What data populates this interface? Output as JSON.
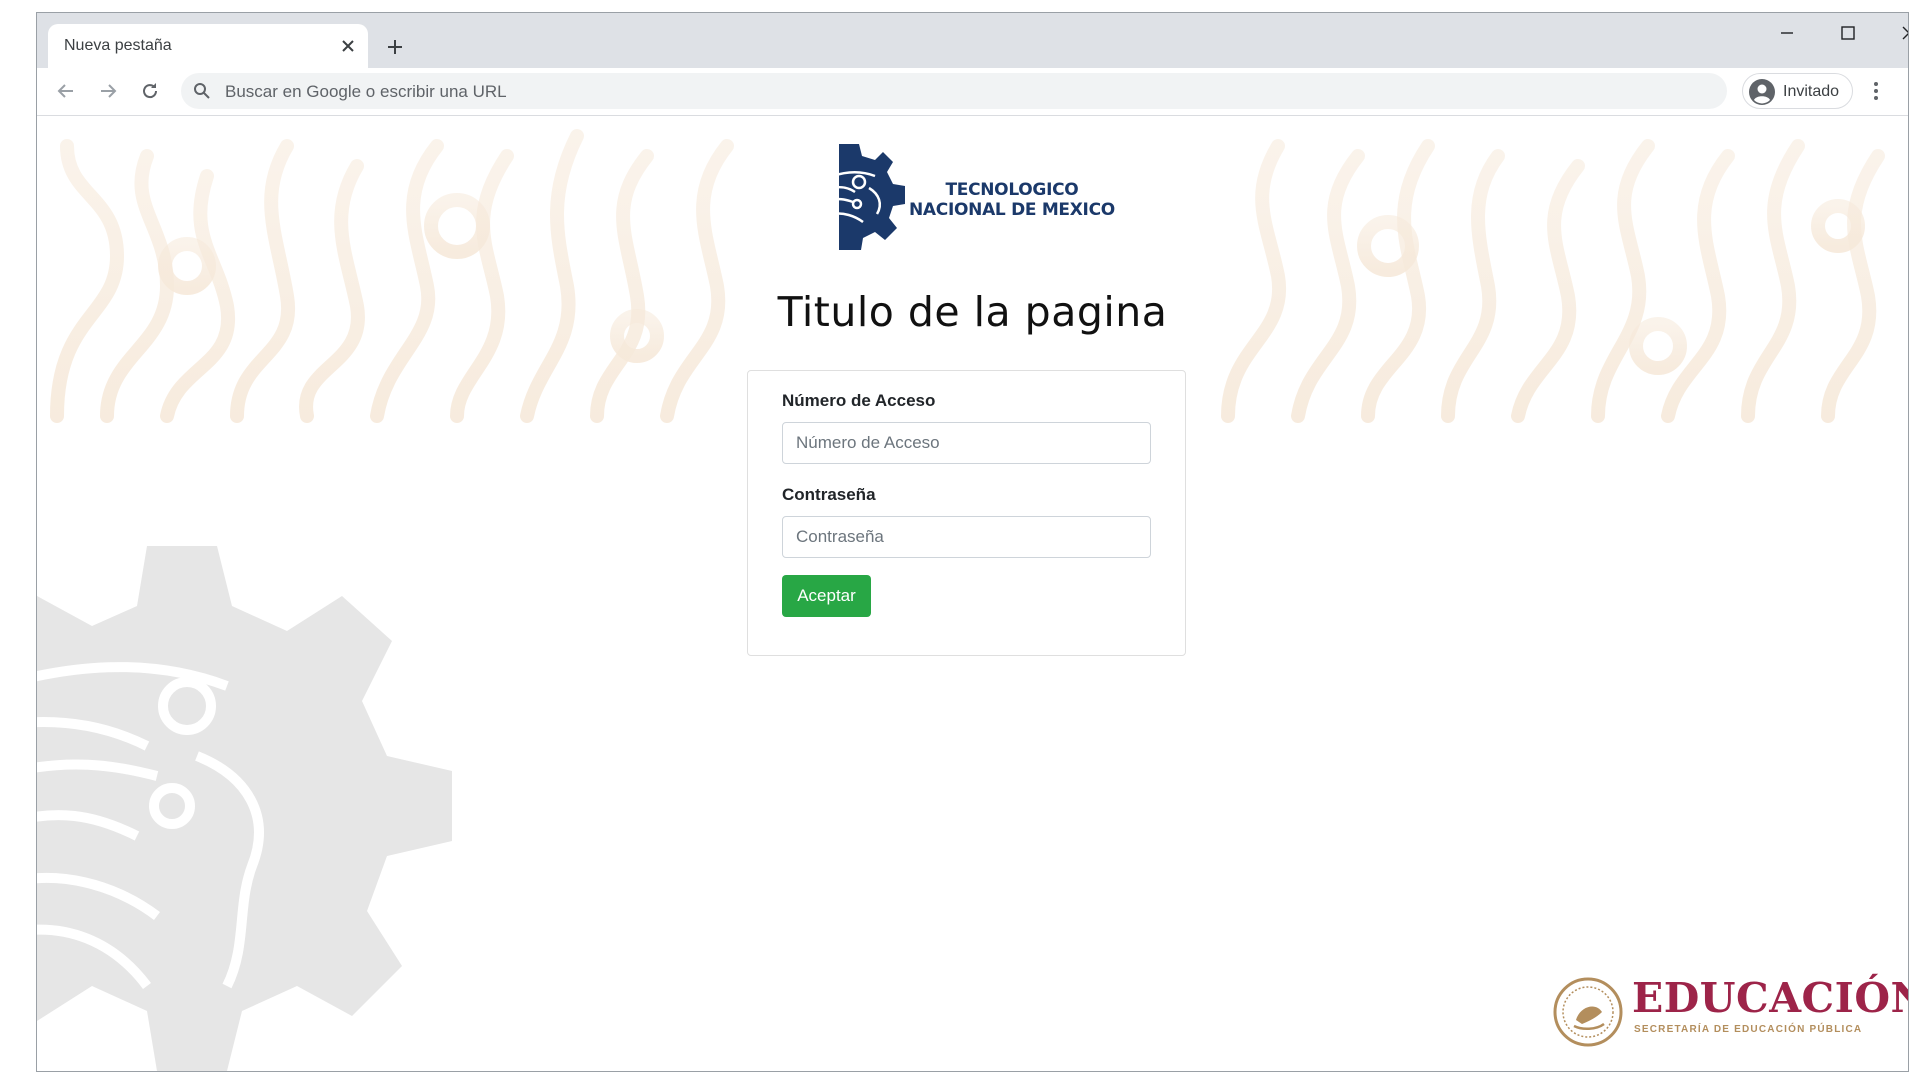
{
  "browser": {
    "tab_title": "Nueva pestaña",
    "omnibox_placeholder": "Buscar en Google o escribir una URL",
    "profile_label": "Invitado"
  },
  "page": {
    "logo_line1": "TECNOLOGICO",
    "logo_line2": "NACIONAL DE MEXICO",
    "title": "Titulo de la pagina",
    "form": {
      "access_label": "Número de Acceso",
      "access_placeholder": "Número de Acceso",
      "password_label": "Contraseña",
      "password_placeholder": "Contraseña",
      "submit_label": "Aceptar"
    },
    "footer_logo_title": "EDUCACIÓN",
    "footer_logo_subtitle": "SECRETARÍA DE EDUCACIÓN PÚBLICA"
  },
  "colors": {
    "accent_green": "#28a745",
    "tecnm_blue": "#1b396a",
    "sep_maroon": "#9d2449",
    "sep_gold": "#b38e5d"
  },
  "icons": [
    "close-icon",
    "plus-icon",
    "minimize-icon",
    "maximize-icon",
    "back-arrow-icon",
    "forward-arrow-icon",
    "reload-icon",
    "search-icon",
    "avatar-icon",
    "kebab-menu-icon"
  ]
}
